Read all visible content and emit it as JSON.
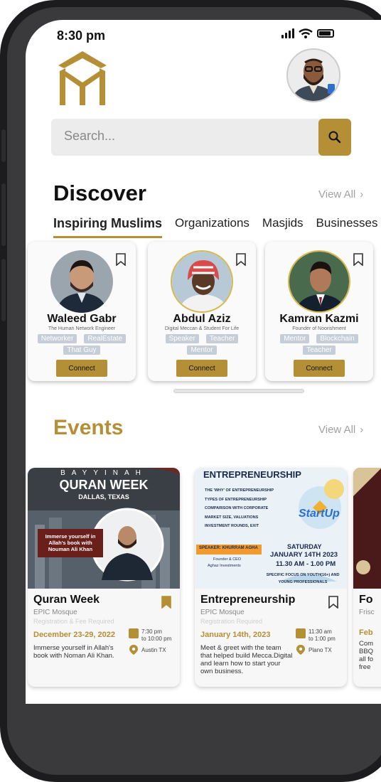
{
  "status_bar": {
    "time": "8:30 pm"
  },
  "search": {
    "placeholder": "Search..."
  },
  "discover": {
    "title": "Discover",
    "view_all": "View All",
    "tabs": [
      "Inspiring Muslims",
      "Organizations",
      "Masjids",
      "Businesses"
    ],
    "people": [
      {
        "name": "Waleed Gabr",
        "tagline": "The Human Network Engineer",
        "tags": [
          "Networker",
          "RealEstate",
          "That Guy"
        ],
        "connect": "Connect"
      },
      {
        "name": "Abdul Aziz",
        "tagline": "Digital Meccan & Student For Life",
        "tags": [
          "Speaker",
          "Teacher",
          "Mentor"
        ],
        "connect": "Connect"
      },
      {
        "name": "Kamran Kazmi",
        "tagline": "Founder of Noorishment",
        "tags": [
          "Mentor",
          "Blockchain",
          "Teacher"
        ],
        "connect": "Connect"
      }
    ]
  },
  "events": {
    "title": "Events",
    "view_all": "View All",
    "items": [
      {
        "name": "Quran Week",
        "venue": "EPIC Mosque",
        "fee": "Registration & Fee Required",
        "date": "December 23-29, 2022",
        "time_from": "7:30 pm",
        "time_to": "to 10:00 pm",
        "location": "Austin TX",
        "description": "Immerse yourself in Allah's book with Noman Ali Khan.",
        "banner": {
          "top": "BAYYINAH",
          "headline": "QURAN WEEK",
          "city": "DALLAS, TEXAS",
          "tagline": "Immerse yourself in Allah's book with Nouman Ali Khan"
        }
      },
      {
        "name": "Entrepreneurship",
        "venue": "EPIC Mosque",
        "fee": "Registration Required",
        "date": "January 14th, 2023",
        "time_from": "11:30 am",
        "time_to": "to 1:00 pm",
        "location": "Plano TX",
        "description": "Meet & greet with the team that helped build Mecca.Digital and learn how to start your own business.",
        "banner": {
          "headline": "ENTREPRENEURSHIP",
          "bullets": [
            "The 'Why' of entrepreneurship",
            "Types of entrepreneurship",
            "Comparison with corporate",
            "Market size, valuations",
            "Investment rounds, exit"
          ],
          "startup": "StartUp",
          "speaker": "Speaker: Khurram Agha",
          "speaker_role": "Founder & CEO",
          "speaker_org": "Aghaz Investments",
          "day": "SATURDAY",
          "date": "JANUARY 14TH 2023",
          "time": "11.30 AM - 1.00 PM",
          "focus": "Specific focus on youth(16+) and young professionals"
        }
      },
      {
        "name": "Fo",
        "venue": "Frisc",
        "date": "Feb",
        "description": "Com BBQ all fo free"
      }
    ]
  },
  "colors": {
    "accent": "#b58f36",
    "chip": "#c7cdd6"
  }
}
